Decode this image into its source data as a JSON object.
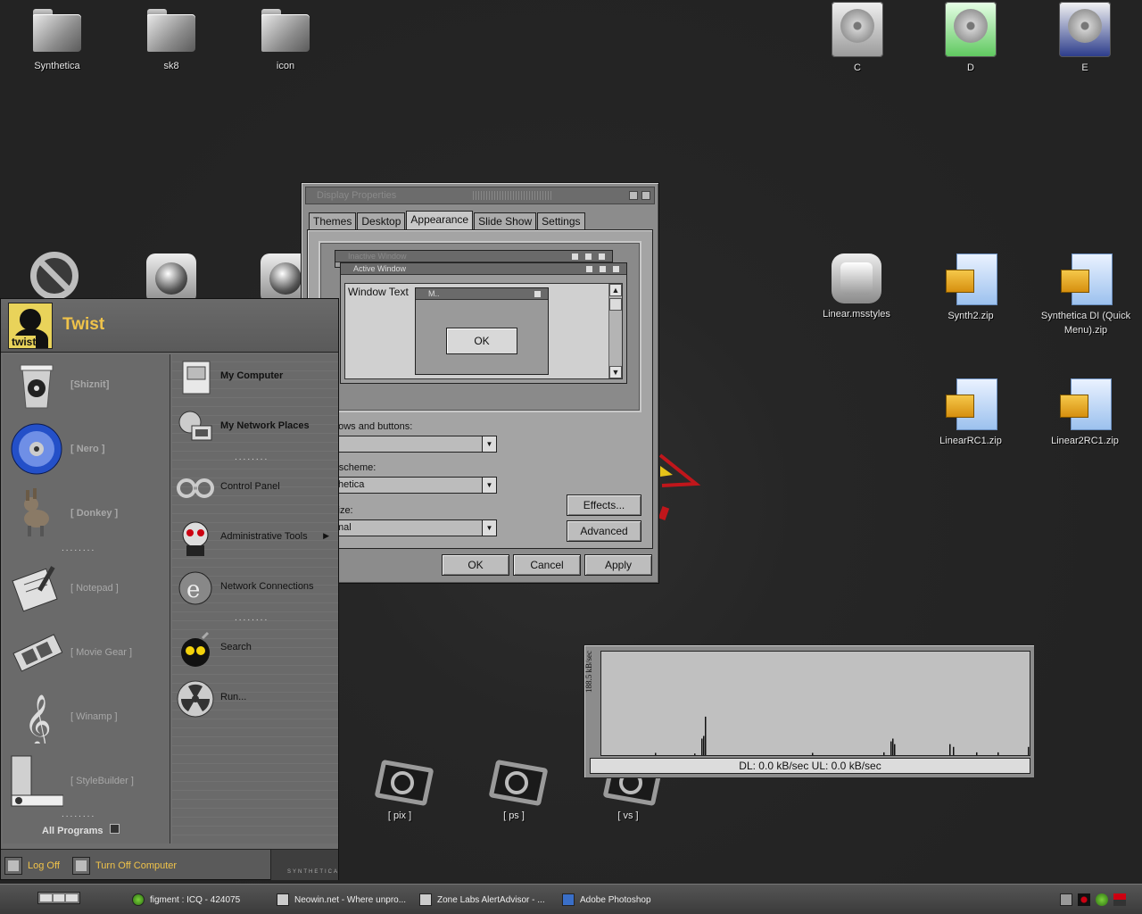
{
  "desktop_icons": [
    {
      "label": "Synthetica",
      "icon": "folder-icon"
    },
    {
      "label": "sk8",
      "icon": "folder-icon"
    },
    {
      "label": "icon",
      "icon": "folder-icon"
    },
    {
      "label": "C",
      "icon": "hard-drive-icon"
    },
    {
      "label": "D",
      "icon": "hard-drive-icon"
    },
    {
      "label": "E",
      "icon": "hard-drive-icon"
    },
    {
      "label": "Linear.msstyles",
      "icon": "msstyles-icon"
    },
    {
      "label": "Synth2.zip",
      "icon": "zip-icon"
    },
    {
      "label": "Synthetica DI (Quick Menu).zip",
      "icon": "zip-icon"
    },
    {
      "label": "LinearRC1.zip",
      "icon": "zip-icon"
    },
    {
      "label": "Linear2RC1.zip",
      "icon": "zip-icon"
    },
    {
      "label": "[ pix ]",
      "icon": "camera-icon"
    },
    {
      "label": "[ ps ]",
      "icon": "photoshop-icon"
    },
    {
      "label": "[ vs ]",
      "icon": "camera-icon"
    }
  ],
  "display_properties": {
    "title": "Display Properties",
    "tabs": [
      "Themes",
      "Desktop",
      "Appearance",
      "Slide Show",
      "Settings"
    ],
    "active_tab": "Appearance",
    "preview": {
      "inactive_title": "Inactive Window",
      "active_title": "Active Window",
      "window_text": "Window Text",
      "message_title": "M..",
      "message_ok": "OK"
    },
    "fields": {
      "windows_buttons_label": "dows and buttons:",
      "windows_buttons_value": "",
      "color_scheme_label": "r scheme:",
      "color_scheme_value": "thetica",
      "font_size_label": "size:",
      "font_size_value": "mal"
    },
    "buttons": {
      "effects": "Effects...",
      "advanced": "Advanced",
      "ok": "OK",
      "cancel": "Cancel",
      "apply": "Apply"
    }
  },
  "start_menu": {
    "user": "Twist",
    "avatar_text": "twist",
    "left_items": [
      "[Shiznit]",
      "[ Nero ]",
      "[ Donkey ]",
      "[ Notepad ]",
      "[ Movie Gear ]",
      "[ Winamp ]",
      "[ StyleBuilder ]"
    ],
    "dots": "........",
    "all_programs": "All Programs",
    "right_items": [
      {
        "label": "My Computer",
        "bold": true
      },
      {
        "label": "My Network Places",
        "bold": true
      },
      {
        "label": "Control Panel",
        "bold": false
      },
      {
        "label": "Administrative Tools",
        "bold": false
      },
      {
        "label": "Network Connections",
        "bold": false
      },
      {
        "label": "Search",
        "bold": false
      },
      {
        "label": "Run...",
        "bold": false
      }
    ],
    "log_off": "Log Off",
    "turn_off": "Turn Off Computer",
    "brand": "SYNTHETICA"
  },
  "network_graph": {
    "y_label": "188.5 kB/sec",
    "status": "DL: 0.0 kB/sec  UL: 0.0 kB/sec"
  },
  "chart_data": {
    "type": "bar",
    "ylabel": "188.5 kB/sec",
    "ylim": [
      0,
      188.5
    ],
    "x": [
      30,
      52,
      56,
      57,
      58,
      118,
      158,
      162,
      163,
      164,
      195,
      197,
      210,
      222,
      239
    ],
    "values": [
      4,
      3,
      30,
      35,
      70,
      4,
      5,
      25,
      30,
      20,
      20,
      15,
      5,
      5,
      15
    ]
  },
  "taskbar": {
    "items": [
      "figment : ICQ - 424075",
      "Neowin.net - Where unpro...",
      "Zone Labs AlertAdvisor - ...",
      "Adobe Photoshop"
    ]
  }
}
